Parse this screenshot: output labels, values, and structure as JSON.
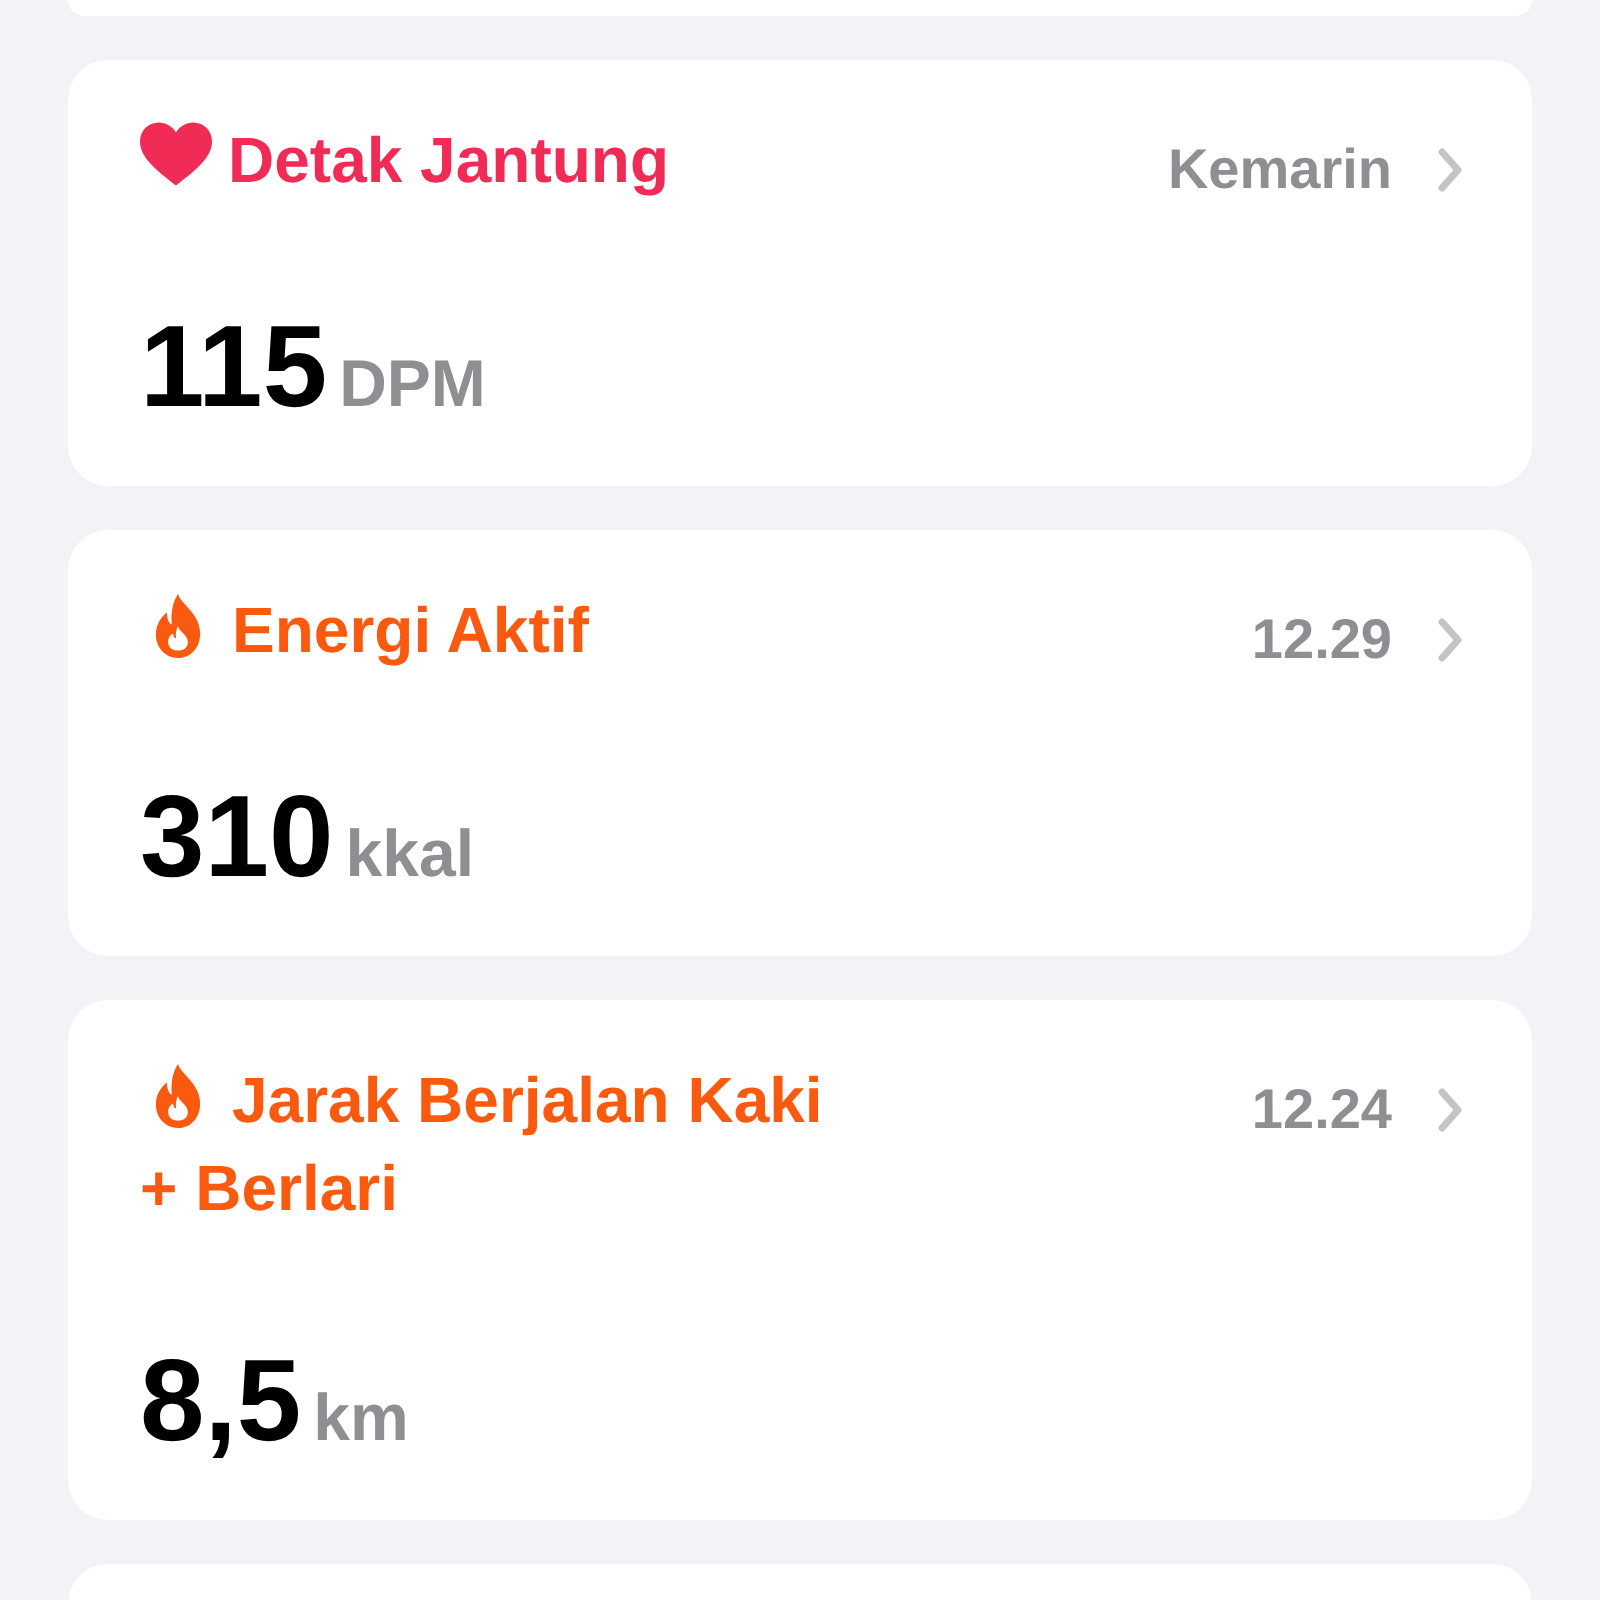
{
  "cards": [
    {
      "kind": "heart",
      "color": "#f02c56",
      "title": "Detak Jantung",
      "time": "Kemarin",
      "value": "115",
      "unit": "DPM"
    },
    {
      "kind": "flame",
      "color": "#fa5a0f",
      "title": "Energi Aktif",
      "time": "12.29",
      "value": "310",
      "unit": "kkal"
    },
    {
      "kind": "flame",
      "color": "#fa5a0f",
      "title": "Jarak Berjalan Kaki + Berlari",
      "time": "12.24",
      "value": "8,5",
      "unit": "km"
    }
  ]
}
